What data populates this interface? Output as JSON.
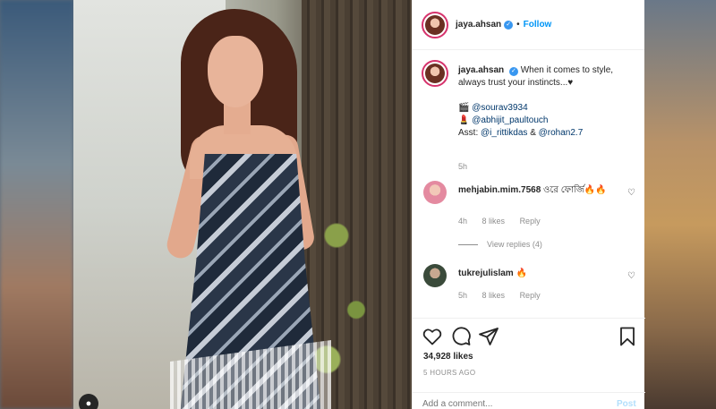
{
  "post": {
    "username": "jaya.ahsan",
    "verified_glyph": "✓",
    "separator": "•",
    "follow_label": "Follow"
  },
  "caption": {
    "username": "jaya.ahsan",
    "text": "When it comes to style, always trust your instincts...♥",
    "line1_icon": "🎬",
    "line1_tag": "@sourav3934",
    "line2_icon": "💄",
    "line2_tag": "@abhijit_paultouch",
    "line3_prefix": "Asst:",
    "line3_tag1": "@i_rittikdas",
    "line3_amp": "&",
    "line3_tag2": "@rohan2.7",
    "time": "5h"
  },
  "comments": [
    {
      "username": "mehjabin.mim.7568",
      "text": "ওরে ফোর্জি🔥🔥",
      "time": "4h",
      "likes": "8 likes",
      "reply": "Reply",
      "view_replies": "View replies (4)",
      "avatar_color": "#e48aa0"
    },
    {
      "username": "tukrejulislam",
      "text": "🔥",
      "time": "5h",
      "likes": "8 likes",
      "reply": "Reply",
      "avatar_color": "#3a4a3a"
    }
  ],
  "actions": {
    "likes": "34,928 likes",
    "time_ago": "5 HOURS AGO",
    "comment_placeholder": "Add a comment...",
    "post_label": "Post",
    "icons": [
      "heart-icon",
      "comment-icon",
      "share-icon",
      "bookmark-icon"
    ]
  },
  "colors": {
    "follow_blue": "#0095f6",
    "verified_blue": "#3897f0",
    "story_ring": "#d6336c"
  }
}
